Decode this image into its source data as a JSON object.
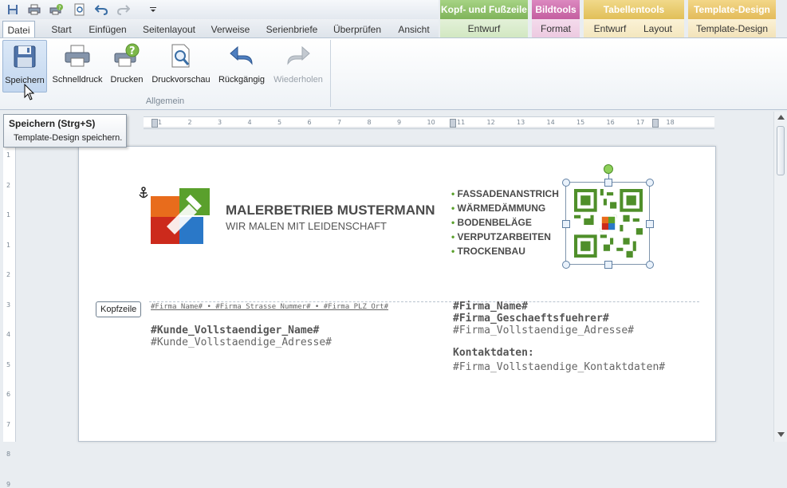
{
  "tabs": [
    "Datei",
    "Start",
    "Einfügen",
    "Seitenlayout",
    "Verweise",
    "Serienbriefe",
    "Überprüfen",
    "Ansicht"
  ],
  "context_groups": [
    {
      "header": "Kopf- und Fußzeile",
      "tabs": [
        "Entwurf"
      ],
      "color": "#8fbf6a"
    },
    {
      "header": "Bildtools",
      "tabs": [
        "Format"
      ],
      "color": "#c96aa8"
    },
    {
      "header": "Tabellentools",
      "tabs": [
        "Entwurf",
        "Layout"
      ],
      "color": "#e0c060"
    },
    {
      "header": "Template-Design",
      "tabs": [
        "Template-Design"
      ],
      "color": "#e8c468"
    }
  ],
  "ribbon": {
    "buttons": [
      "Speichern",
      "Schnelldruck",
      "Drucken",
      "Druckvorschau",
      "Rückgängig",
      "Wiederholen"
    ],
    "group_label": "Allgemein"
  },
  "tooltip": {
    "title": "Speichern (Strg+S)",
    "desc": "Template-Design speichern."
  },
  "ruler": {
    "h_ticks": [
      "1",
      "2",
      "3",
      "4",
      "5",
      "6",
      "7",
      "8",
      "9",
      "10",
      "11",
      "12",
      "13",
      "14",
      "15",
      "16",
      "17",
      "18"
    ],
    "v_ticks": [
      "1",
      "2",
      "1",
      "1",
      "2",
      "3",
      "4",
      "5",
      "6",
      "7",
      "8",
      "9"
    ]
  },
  "doc": {
    "company_name": "MALERBETRIEB MUSTERMANN",
    "slogan": "WIR MALEN MIT LEIDENSCHAFT",
    "services": [
      "FASSADENANSTRICH",
      "WÄRMEDÄMMUNG",
      "BODENBELÄGE",
      "VERPUTZARBEITEN",
      "TROCKENBAU"
    ],
    "header_badge": "Kopfzeile",
    "sender_line": "#Firma_Name# • #Firma_Strasse_Nummer# • #Firma_PLZ_Ort#",
    "customer_name": "#Kunde_Vollstaendiger_Name#",
    "customer_address": "#Kunde_Vollstaendige_Adresse#",
    "firm_name": "#Firma_Name#",
    "firm_manager": "#Firma_Geschaeftsfuehrer#",
    "firm_address": "#Firma_Vollstaendige_Adresse#",
    "contact_heading": "Kontaktdaten:",
    "contact_data": "#Firma_Vollstaendige_Kontaktdaten#"
  }
}
